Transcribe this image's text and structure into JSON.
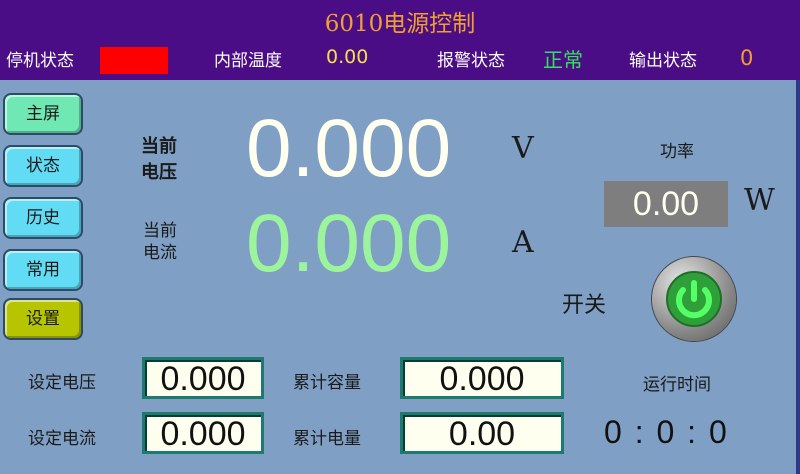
{
  "header": {
    "title": "6010电源控制"
  },
  "status_bar": {
    "stop_label": "停机状态",
    "temp_label": "内部温度",
    "temp_value": "0.00",
    "alarm_label": "报警状态",
    "alarm_value": "正常",
    "output_label": "输出状态",
    "output_value": "0"
  },
  "nav": [
    {
      "label": "主屏",
      "color": "#6fe8b4"
    },
    {
      "label": "状态",
      "color": "#62dcf4"
    },
    {
      "label": "历史",
      "color": "#62dcf4"
    },
    {
      "label": "常用",
      "color": "#62dcf4"
    },
    {
      "label": "设置",
      "color": "#b7c400"
    }
  ],
  "readout": {
    "voltage_label_1": "当前",
    "voltage_label_2": "电压",
    "voltage_value": "0.000",
    "voltage_unit": "V",
    "current_label_1": "当前",
    "current_label_2": "电流",
    "current_value": "0.000",
    "current_unit": "A"
  },
  "power": {
    "label": "功率",
    "value": "0.00",
    "unit": "W"
  },
  "switch": {
    "label": "开关"
  },
  "settings": {
    "set_voltage_label": "设定电压",
    "set_voltage_value": "0.000",
    "set_current_label": "设定电流",
    "set_current_value": "0.000",
    "capacity_label": "累计容量",
    "capacity_value": "0.000",
    "energy_label": "累计电量",
    "energy_value": "0.00"
  },
  "runtime": {
    "label": "运行时间",
    "value": "0 : 0 : 0"
  },
  "colors": {
    "background": "#7f9fc4",
    "header": "#4b0d85",
    "title": "#f0a030",
    "stop_indicator": "#ff0000",
    "alarm_ok": "#35e35a",
    "voltage": "#fffff0",
    "current": "#9cf59c"
  }
}
